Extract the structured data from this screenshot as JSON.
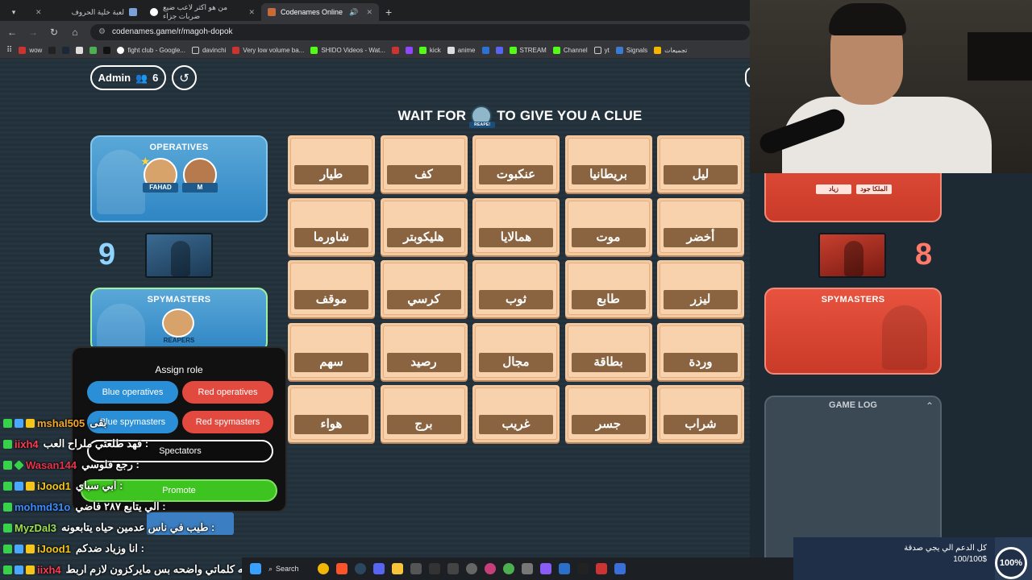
{
  "browser": {
    "tabs": [
      {
        "title": "لعبة خلية الحروف",
        "active": false
      },
      {
        "title": "من هو اكثر لاعب ضيع ضربات جزاء",
        "active": false
      },
      {
        "title": "Codenames Online",
        "active": true
      }
    ],
    "url": "codenames.game/r/magoh-dopok",
    "bookmarks": [
      "wow",
      "fight club - Google...",
      "davinchi",
      "Very low volume ba...",
      "SHIDO Videos - Wat...",
      "kick",
      "anime",
      "STREAM",
      "Channel",
      "yt",
      "Signals",
      "تجميعات"
    ]
  },
  "header": {
    "admin_label": "Admin",
    "player_count": "6",
    "clue_prefix": "WAIT FOR",
    "clue_suffix": "TO GIVE YOU A CLUE",
    "clue_avatar_tag": "REAPE!"
  },
  "blue_team": {
    "operatives_title": "OPERATIVES",
    "operatives": [
      "FAHAD",
      "M"
    ],
    "score": "9",
    "spymasters_title": "SPYMASTERS",
    "spymasters": [
      "REAPERS"
    ]
  },
  "red_team": {
    "operatives": [
      "زياد",
      "الملكا جود"
    ],
    "score": "8",
    "spymasters_title": "SPYMASTERS"
  },
  "board": [
    [
      "طيار",
      "كف",
      "عنكبوت",
      "بريطانيا",
      "ليل"
    ],
    [
      "شاورما",
      "هليكوبتر",
      "همالايا",
      "موت",
      "أخضر"
    ],
    [
      "موقف",
      "كرسي",
      "ثوب",
      "طابع",
      "ليزر"
    ],
    [
      "سهم",
      "رصيد",
      "مجال",
      "بطاقة",
      "وردة"
    ],
    [
      "هواء",
      "برج",
      "غريب",
      "جسر",
      "شراب"
    ]
  ],
  "game_log": {
    "title": "GAME LOG"
  },
  "assign_role": {
    "title": "Assign role",
    "blue_operatives": "Blue operatives",
    "red_operatives": "Red operatives",
    "blue_spymasters": "Blue spymasters",
    "red_spymasters": "Red spymasters",
    "spectators": "Spectators",
    "promote": "Promote"
  },
  "chat": [
    {
      "name": "mshal505",
      "color": "#f5a623",
      "message": "بقى"
    },
    {
      "name": "iixh4",
      "color": "#ff3b4f",
      "message": "فهد طلعتي ملراح العب :"
    },
    {
      "name": "Wasan144",
      "color": "#e8334a",
      "message": "رجع فلوسي :"
    },
    {
      "name": "iJood1",
      "color": "#f5c518",
      "message": "ابي سباي :"
    },
    {
      "name": "mohmd31o",
      "color": "#3c8cff",
      "message": "الي يتابع ٢٨٧ فاضي :"
    },
    {
      "name": "MyzDal3",
      "color": "#9be04f",
      "message": "طيب في ناس عدمين حياه يتابعونه :"
    },
    {
      "name": "iJood1",
      "color": "#f5c518",
      "message": "انا وزياد ضدكم :"
    },
    {
      "name": "iixh4",
      "color": "#ff3b4f",
      "message": "واللهه كلماتي واضحه بس مايركزون لازم اربط :"
    }
  ],
  "donation": {
    "text": "كل الدعم الي يجي صدقة",
    "amount": "100/100$",
    "percent": "100%"
  },
  "taskbar": {
    "search_label": "Search"
  },
  "colors": {
    "blue": "#2f86c4",
    "red": "#e24a3f",
    "card": "#f4c9a0",
    "card_label": "#8a6440"
  }
}
